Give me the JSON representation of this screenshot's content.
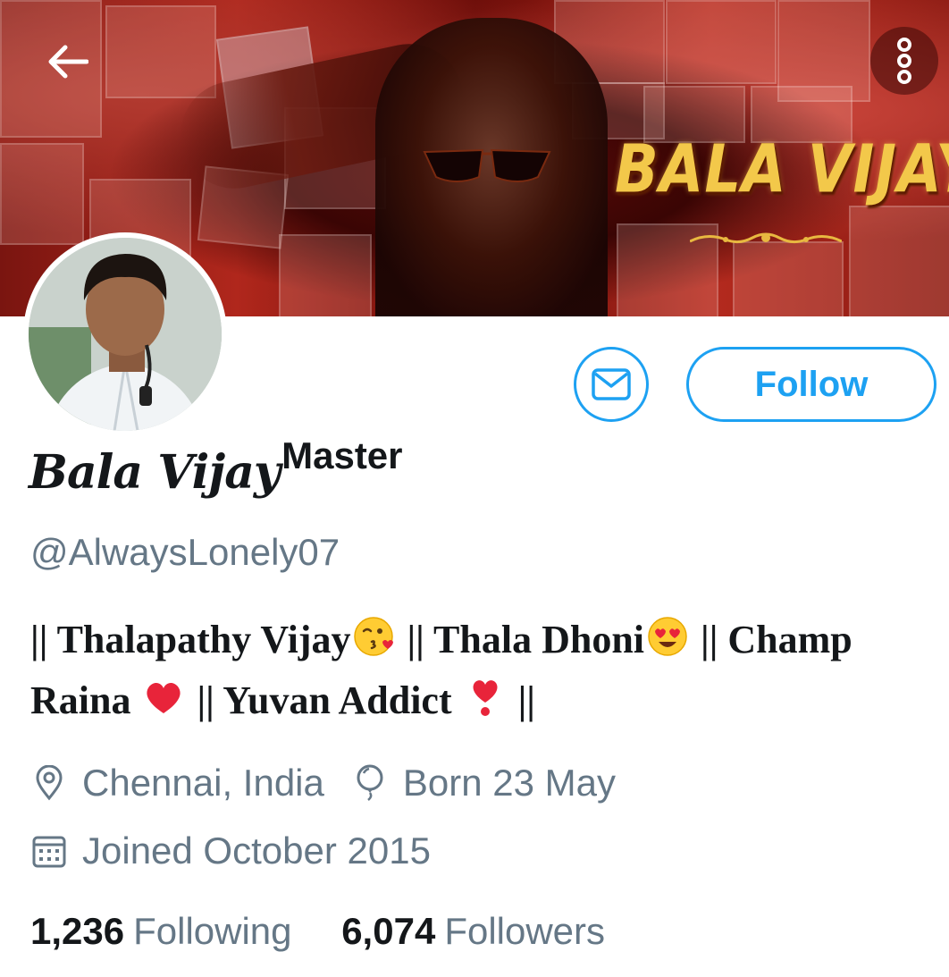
{
  "banner": {
    "title": "BALA VIJAY"
  },
  "header": {
    "back_icon": "arrow-left-icon",
    "more_icon": "more-vertical-icon"
  },
  "actions": {
    "message_icon": "envelope-icon",
    "follow_label": "Follow"
  },
  "profile": {
    "display_name": "Bala Vijay",
    "display_name_suffix": "Master",
    "handle": "@AlwaysLonely07",
    "bio": {
      "part1": "|| Thalapathy Vijay",
      "emoji1": "face-blowing-kiss",
      "part2": " || Thala Dhoni",
      "emoji2": "heart-eyes",
      "part3": " || Champ Raina ",
      "emoji3": "red-heart",
      "part4": " || Yuvan Addict ",
      "emoji4": "heavy-heart-exclamation",
      "part5": " ||"
    },
    "location": "Chennai, India",
    "location_icon": "location-pin-icon",
    "birthday": "Born 23 May",
    "birthday_icon": "balloon-icon",
    "joined": "Joined October 2015",
    "joined_icon": "calendar-icon"
  },
  "stats": {
    "following_count": "1,236",
    "following_label": "Following",
    "followers_count": "6,074",
    "followers_label": "Followers"
  },
  "colors": {
    "accent": "#1da1f2",
    "secondary_text": "#657786",
    "primary_text": "#14171a",
    "banner_title": "#f3c84a"
  }
}
